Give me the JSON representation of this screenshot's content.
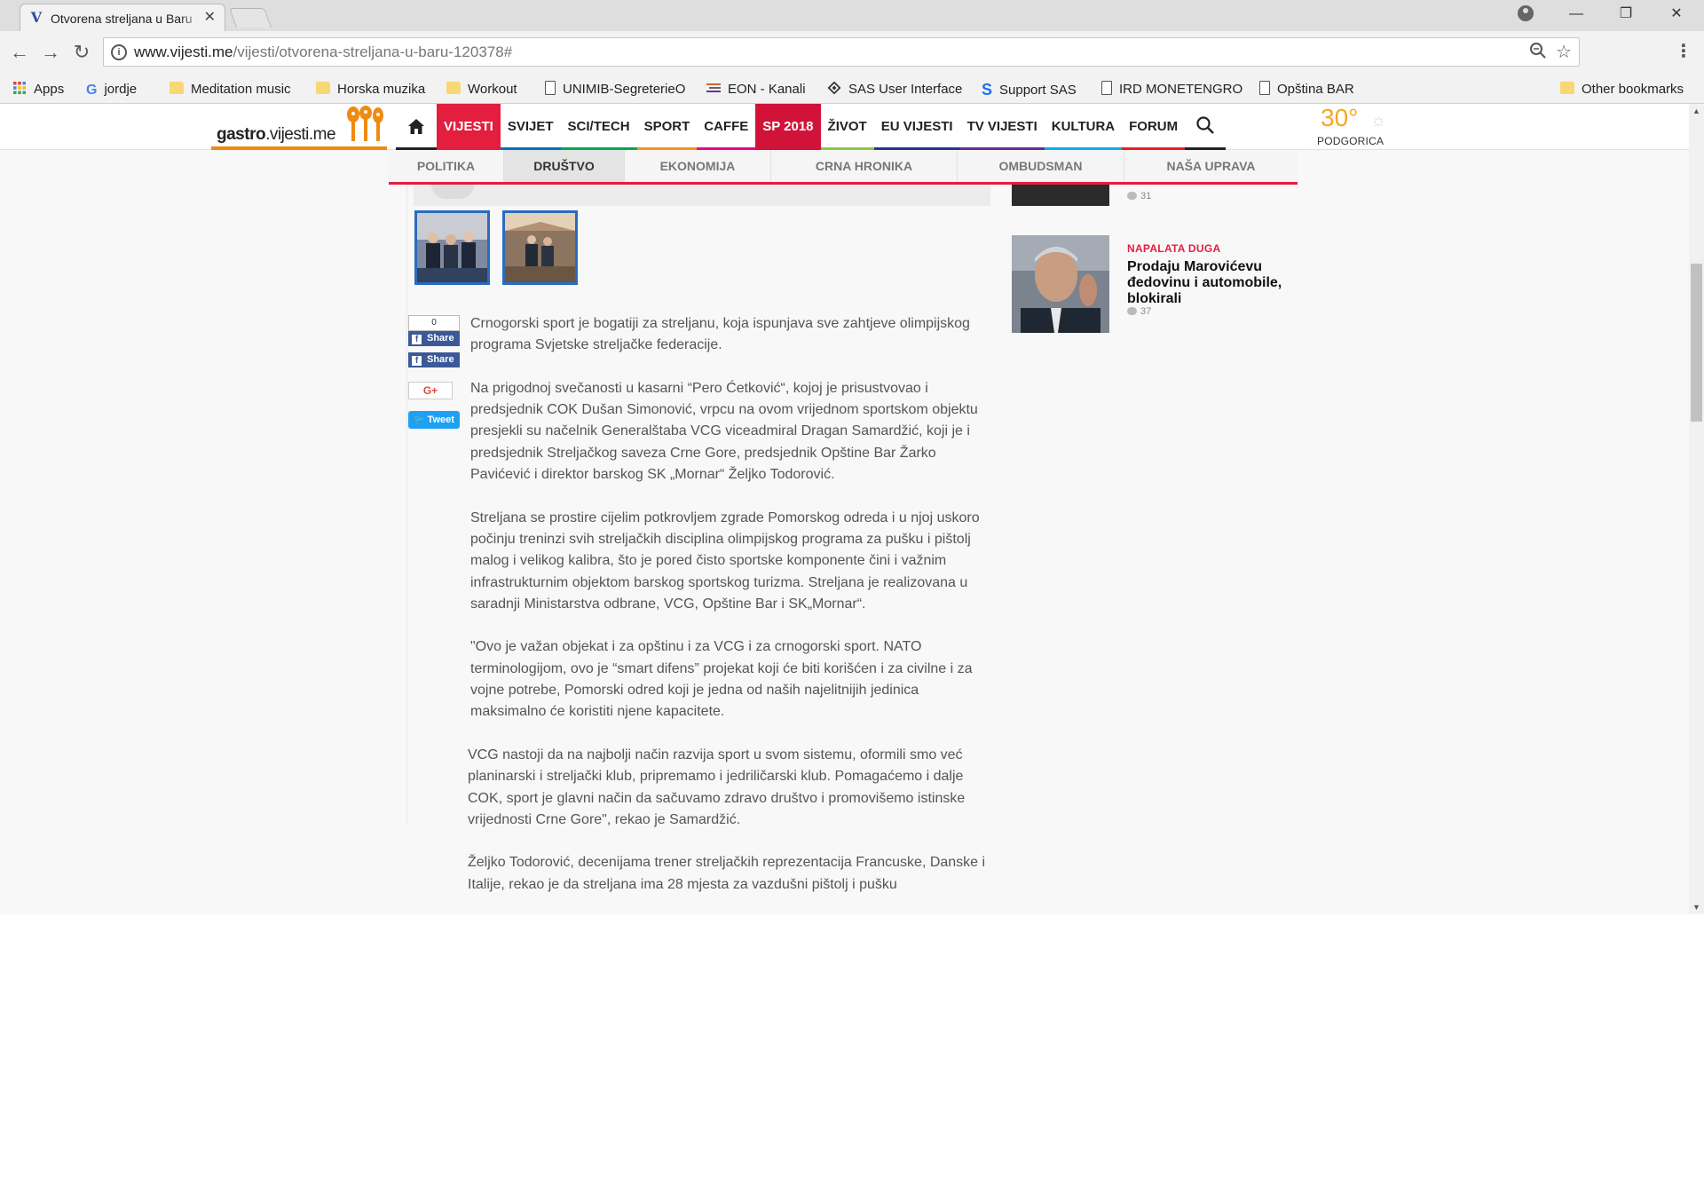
{
  "browser": {
    "tab_title": "Otvorena streljana u Baru",
    "favicon_letter": "V",
    "close_glyph": "✕",
    "url_host": "www.vijesti.me",
    "url_path": "/vijesti/otvorena-streljana-u-baru-120378#",
    "window_controls": [
      "—",
      "❐",
      "✕"
    ],
    "nav_buttons": [
      "←",
      "→",
      "↻"
    ],
    "icons": [
      "info-icon",
      "zoom-icon",
      "star-icon",
      "menu-icon",
      "profile-icon"
    ]
  },
  "bookmarks": [
    {
      "label": "Apps",
      "icon": "apps-icon"
    },
    {
      "label": "jordje",
      "icon": "google-icon"
    },
    {
      "label": "Meditation music",
      "icon": "folder-icon"
    },
    {
      "label": "Horska muzika",
      "icon": "folder-icon"
    },
    {
      "label": "Workout",
      "icon": "folder-icon"
    },
    {
      "label": "UNIMIB-SegreterieO",
      "icon": "page-icon"
    },
    {
      "label": "EON - Kanali",
      "icon": "eon-icon"
    },
    {
      "label": "SAS User Interface",
      "icon": "sas-icon"
    },
    {
      "label": "Support SAS",
      "icon": "sas-s-icon"
    },
    {
      "label": "IRD MONETENGRO",
      "icon": "page-icon"
    },
    {
      "label": "Opština BAR",
      "icon": "page-icon"
    },
    {
      "label": "Other bookmarks",
      "icon": "folder-icon"
    }
  ],
  "site": {
    "logo_brand": "gastro",
    "logo_rest": "vijesti.me",
    "nav": [
      {
        "label": "VIJESTI",
        "color": "#e41e3f"
      },
      {
        "label": "SVIJET",
        "color": "#0072bc"
      },
      {
        "label": "SCI/TECH",
        "color": "#00a651"
      },
      {
        "label": "SPORT",
        "color": "#f7941d"
      },
      {
        "label": "CAFFE",
        "color": "#ec008c"
      },
      {
        "label": "SP 2018",
        "color": "#d1133a"
      },
      {
        "label": "ŽIVOT",
        "color": "#8dc63f"
      },
      {
        "label": "EU VIJESTI",
        "color": "#2e3192"
      },
      {
        "label": "TV VIJESTI",
        "color": "#662d91"
      },
      {
        "label": "KULTURA",
        "color": "#00aeef"
      },
      {
        "label": "FORUM",
        "color": "#ed1c24"
      }
    ],
    "weather": {
      "temp": "30°",
      "city": "PODGORICA",
      "icon": "sun-icon"
    },
    "subnav": [
      "POLITIKA",
      "DRUŠTVO",
      "EKONOMIJA",
      "CRNA HRONIKA",
      "OMBUDSMAN",
      "NAŠA UPRAVA"
    ],
    "subnav_current": "DRUŠTVO"
  },
  "social": {
    "fb_count": "0",
    "fb_share": "Share",
    "gplus": "G+",
    "tweet": "Tweet"
  },
  "article": {
    "paragraphs": [
      "Crnogorski sport je bogatiji za streljanu, koja ispunjava sve zahtjeve olimpijskog programa Svjetske streljačke federacije.",
      "Na prigodnoj svečanosti u kasarni “Pero Ćetković“, kojoj je prisustvovao i predsjednik COK Dušan Simonović, vrpcu na ovom vrijednom sportskom objektu presjekli su načelnik Generalštaba VCG viceadmiral Dragan Samardžić, koji je i predsjednik Streljačkog saveza Crne Gore, predsjednik Opštine Bar Žarko Pavićević i direktor barskog SK „Mornar“ Željko Todorović.",
      "Streljana se prostire cijelim potkrovljem zgrade Pomorskog odreda i u njoj uskoro počinju treninzi svih streljačkih disciplina olimpijskog programa za pušku i pištolj malog i velikog kalibra, što je pored čisto sportske komponente čini i važnim infrastrukturnim objektom barskog sportskog turizma. Streljana je realizovana u saradnji Ministarstva odbrane, VCG, Opštine Bar i SK„Mornar“.",
      "\"Ovo je važan objekat i za opštinu i za VCG i za crnogorski sport. NATO terminologijom, ovo je “smart difens” projekat koji će biti korišćen i za civilne i za vojne potrebe, Pomorski odred koji je jedna od naših najelitnijih jedinica maksimalno će koristiti njene kapacitete.",
      "VCG nastoji da na najbolji način razvija sport u svom sistemu, oformili smo već planinarski i streljački klub, pripremamo i jedriličarski klub. Pomagaćemo i dalje COK, sport je glavni način da sačuvamo zdravo društvo i promovišemo istinske vrijednosti Crne Gore\", rekao je Samardžić.",
      "Željko Todorović, decenijama trener streljačkih reprezentacija Francuske, Danske i Italije, rekao je da streljana ima 28 mjesta za vazdušni pištolj i pušku"
    ]
  },
  "sidebar": {
    "top_count": "31",
    "item": {
      "category": "NAPALATA DUGA",
      "title": "Prodaju Marovićevu đedovinu i automobile, blokirali",
      "count": "37"
    }
  }
}
